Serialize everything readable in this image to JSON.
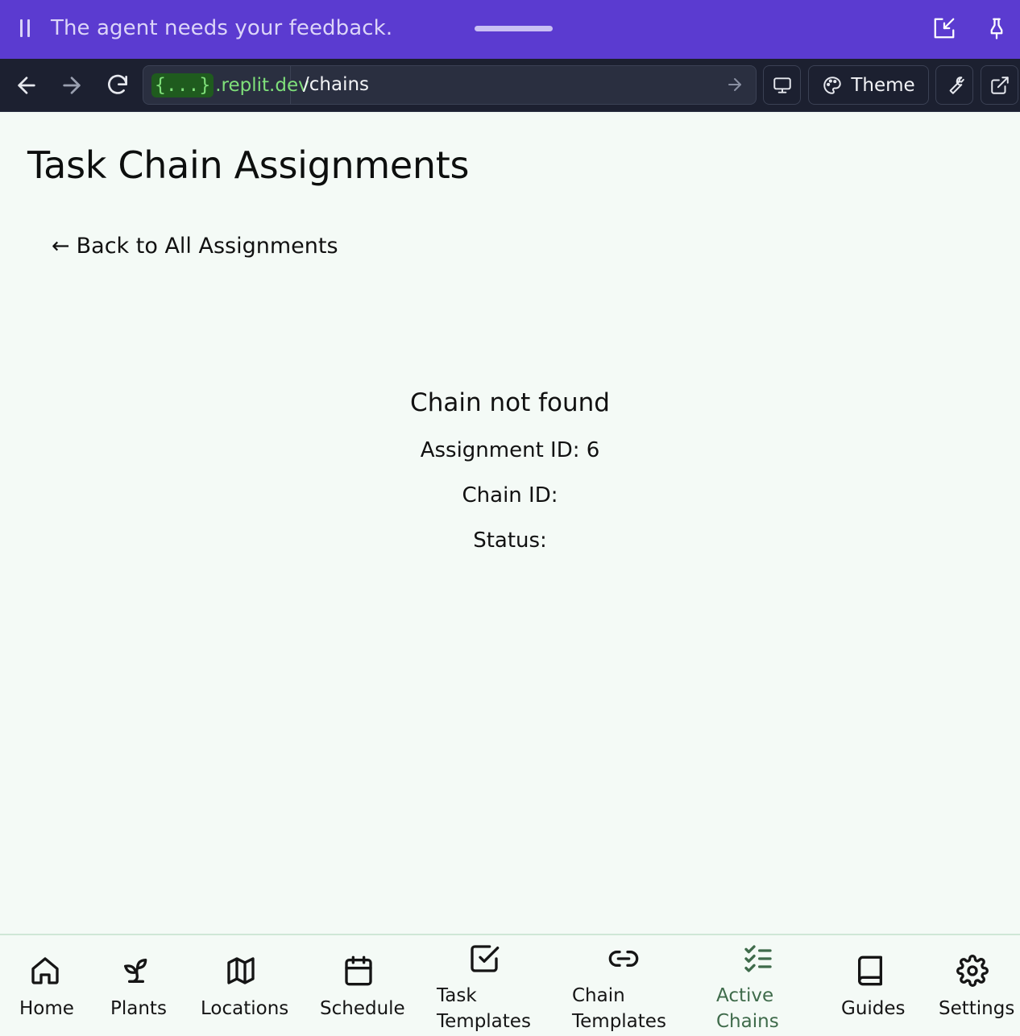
{
  "banner": {
    "message": "The agent needs your feedback."
  },
  "browser": {
    "url_badge": "{...}",
    "url_domain": ".replit.dev",
    "url_path": "/chains",
    "theme_label": "Theme"
  },
  "page": {
    "title": "Task Chain Assignments",
    "back_link": "Back to All Assignments",
    "back_arrow": "←",
    "not_found_title": "Chain not found",
    "assignment_line": "Assignment ID: 6",
    "chain_line": "Chain ID:",
    "status_line": "Status:"
  },
  "nav": {
    "active": "Active Chains",
    "items": [
      {
        "label": "Home",
        "icon": "home-icon"
      },
      {
        "label": "Plants",
        "icon": "sprout-icon"
      },
      {
        "label": "Locations",
        "icon": "map-icon"
      },
      {
        "label": "Schedule",
        "icon": "calendar-icon"
      },
      {
        "label_line1": "Task",
        "label_line2": "Templates",
        "icon": "check-square-icon"
      },
      {
        "label_line1": "Chain",
        "label_line2": "Templates",
        "icon": "link-icon"
      },
      {
        "label_line1": "Active",
        "label_line2": "Chains",
        "icon": "list-checks-icon"
      },
      {
        "label": "Guides",
        "icon": "book-icon"
      },
      {
        "label": "Settings",
        "icon": "gear-icon"
      }
    ]
  },
  "colors": {
    "banner": "#5b3bd0",
    "toolbar": "#1c2030",
    "page_bg": "#f4faf6",
    "active_nav": "#3f6b4b",
    "url_green": "#7fe07a"
  }
}
